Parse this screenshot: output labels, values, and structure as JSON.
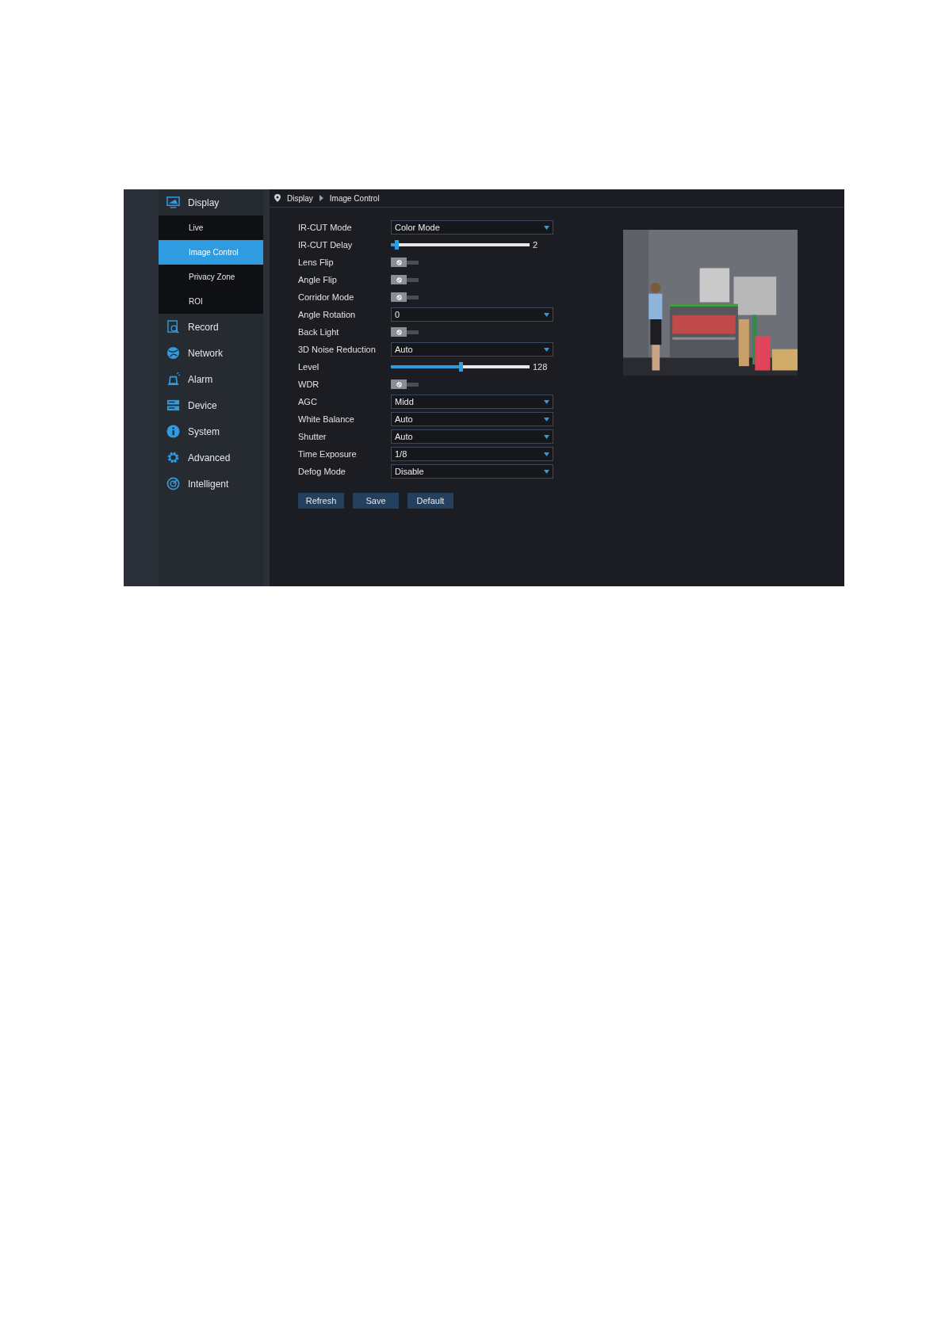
{
  "sidebar": {
    "items": [
      {
        "label": "Display",
        "children": [
          {
            "label": "Live",
            "selected": false
          },
          {
            "label": "Image Control",
            "selected": true
          },
          {
            "label": "Privacy Zone",
            "selected": false
          },
          {
            "label": "ROI",
            "selected": false
          }
        ]
      },
      {
        "label": "Record"
      },
      {
        "label": "Network"
      },
      {
        "label": "Alarm"
      },
      {
        "label": "Device"
      },
      {
        "label": "System"
      },
      {
        "label": "Advanced"
      },
      {
        "label": "Intelligent"
      }
    ]
  },
  "breadcrumb": [
    "Display",
    "Image Control"
  ],
  "settings": [
    {
      "kind": "select",
      "label": "IR-CUT Mode",
      "value": "Color Mode"
    },
    {
      "kind": "slider",
      "label": "IR-CUT Delay",
      "level": 0.04,
      "reading": "2"
    },
    {
      "kind": "toggle",
      "label": "Lens Flip",
      "on": false
    },
    {
      "kind": "toggle",
      "label": "Angle Flip",
      "on": false
    },
    {
      "kind": "toggle",
      "label": "Corridor Mode",
      "on": false
    },
    {
      "kind": "select",
      "label": "Angle Rotation",
      "value": "0"
    },
    {
      "kind": "toggle",
      "label": "Back Light",
      "on": false
    },
    {
      "kind": "select",
      "label": "3D Noise Reduction",
      "value": "Auto"
    },
    {
      "kind": "slider",
      "label": "Level",
      "level": 0.5,
      "reading": "128"
    },
    {
      "kind": "toggle",
      "label": "WDR",
      "on": false
    },
    {
      "kind": "select",
      "label": "AGC",
      "value": "Midd"
    },
    {
      "kind": "select",
      "label": "White Balance",
      "value": "Auto"
    },
    {
      "kind": "select",
      "label": "Shutter",
      "value": "Auto"
    },
    {
      "kind": "select",
      "label": "Time Exposure",
      "value": "1/8"
    },
    {
      "kind": "select",
      "label": "Defog Mode",
      "value": "Disable"
    }
  ],
  "buttons": [
    "Refresh",
    "Save",
    "Default"
  ],
  "preview": {
    "kind": "picture"
  }
}
